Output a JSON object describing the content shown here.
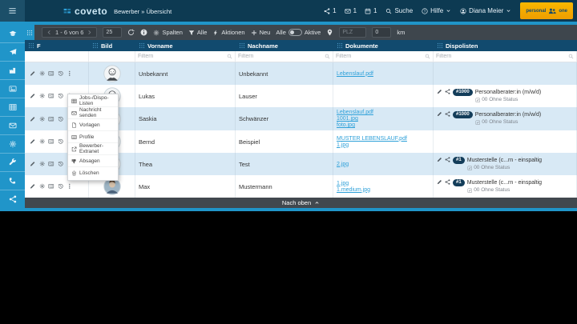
{
  "colors": {
    "accent": "#2095c9",
    "topbar": "#0d3a52",
    "table_header": "#114a6e",
    "row_alt": "#d8e9f5",
    "link": "#2da0d9",
    "badge": "#133d5a",
    "brand_button": "#f5ab00"
  },
  "topbar": {
    "logo_text": "coveto",
    "breadcrumb": "Bewerber » Übersicht",
    "badges": [
      {
        "icon": "share-nodes",
        "count": "1"
      },
      {
        "icon": "envelope",
        "count": "1"
      },
      {
        "icon": "calendar",
        "count": "1"
      }
    ],
    "search_label": "Suche",
    "help_label": "Hilfe",
    "user_name": "Diana Meier",
    "brand_button": {
      "left": "personal",
      "right": "one"
    }
  },
  "sidebar": {
    "items": [
      {
        "icon": "graduation-cap"
      },
      {
        "icon": "paper-plane"
      },
      {
        "icon": "factory"
      },
      {
        "icon": "image"
      },
      {
        "icon": "tableicon"
      },
      {
        "icon": "envelope"
      },
      {
        "icon": "gear"
      },
      {
        "icon": "wrench"
      },
      {
        "icon": "phone"
      },
      {
        "icon": "share-nodes"
      }
    ]
  },
  "toolbar": {
    "pagination": "1 - 6 von 6",
    "page_size": "25",
    "columns_label": "Spalten",
    "filter_all_label": "Alle",
    "actions_label": "Aktionen",
    "new_label": "Neu",
    "toggle": {
      "left": "Alle",
      "right": "Aktive"
    },
    "plz_placeholder": "PLZ",
    "radius_value": "0",
    "radius_unit": "km"
  },
  "table": {
    "columns": [
      {
        "label": "F"
      },
      {
        "label": "Bild"
      },
      {
        "label": "Vorname"
      },
      {
        "label": "Nachname"
      },
      {
        "label": "Dokumente"
      },
      {
        "label": "Dispolisten"
      }
    ],
    "filter_placeholder": "Filtern",
    "rows": [
      {
        "vorname": "Unbekannt",
        "nachname": "Unbekannt",
        "avatar": "cartoon",
        "dokumente": [
          "Lebenslauf.pdf"
        ],
        "dispo": null
      },
      {
        "vorname": "Lukas",
        "nachname": "Lauser",
        "avatar": "cartoon",
        "dokumente": [],
        "dispo": {
          "badge": "#1000",
          "title": "Personalberater:in (m/w/d)",
          "status": "00 Ohne Status"
        }
      },
      {
        "vorname": "Saskia",
        "nachname": "Schwänzer",
        "avatar": "cartoon",
        "dokumente": [
          "Lebenslauf.pdf",
          "1001.jpg",
          "foto.jpg"
        ],
        "dispo": {
          "badge": "#1000",
          "title": "Personalberater:in (m/w/d)",
          "status": "00 Ohne Status"
        }
      },
      {
        "vorname": "Bernd",
        "nachname": "Beispiel",
        "avatar": "cartoon",
        "dokumente": [
          "MUSTER LEBENSLAUF.pdf",
          "1.jpg"
        ],
        "dispo": null
      },
      {
        "vorname": "Thea",
        "nachname": "Test",
        "avatar": "cartoon",
        "dokumente": [
          "2.jpg"
        ],
        "dispo": {
          "badge": "#1",
          "title": "Musterstelle (c...rn - einspaltig",
          "status": "00 Ohne Status"
        }
      },
      {
        "vorname": "Max",
        "nachname": "Mustermann",
        "avatar": "photo",
        "dokumente": [
          "1.jpg",
          "1.medium.jpg"
        ],
        "dispo": {
          "badge": "#1",
          "title": "Musterstelle (c...rn - einspaltig",
          "status": "00 Ohne Status"
        }
      }
    ]
  },
  "context_menu": {
    "items": [
      {
        "icon": "tableicon",
        "label": "Jobs-/Dispo-Listen"
      },
      {
        "icon": "envelope",
        "label": "Nachricht senden"
      },
      {
        "icon": "document",
        "label": "Vorlagen"
      },
      {
        "icon": "card",
        "label": "Profile"
      },
      {
        "icon": "external-link",
        "label": "Bewerber-Extranet"
      },
      {
        "icon": "thumbs-down",
        "label": "Absagen"
      },
      {
        "icon": "trash",
        "label": "Löschen"
      }
    ]
  },
  "footer": {
    "back_to_top": "Nach oben"
  }
}
